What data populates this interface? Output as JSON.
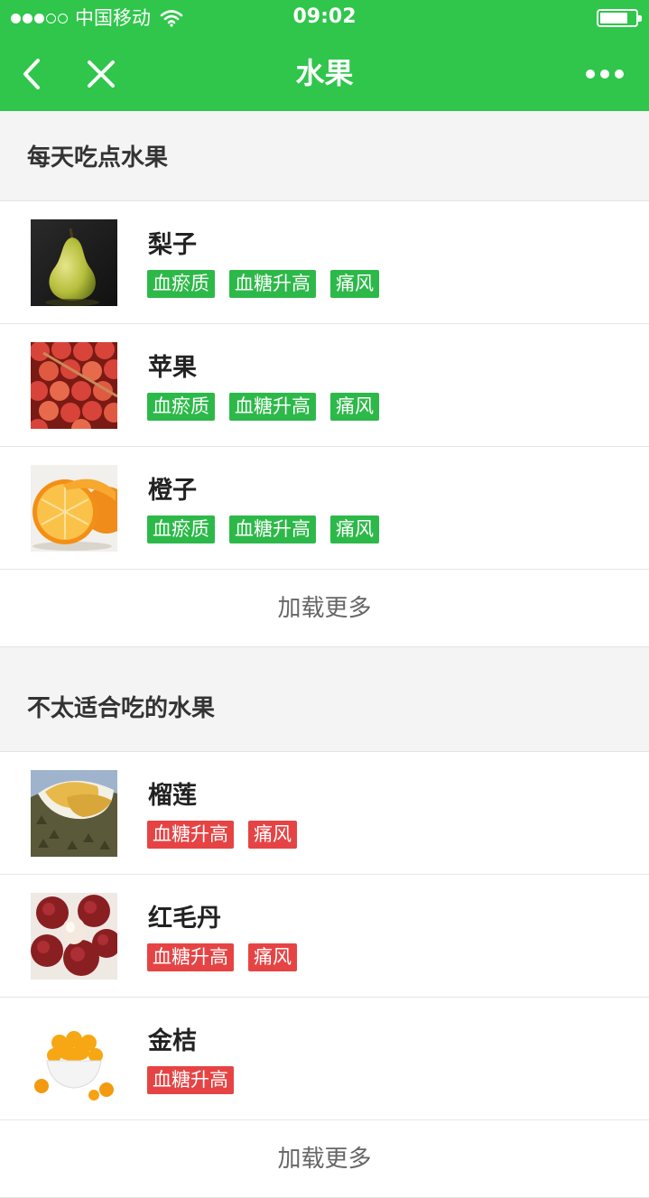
{
  "status_bar": {
    "carrier": "中国移动",
    "time": "09:02"
  },
  "nav": {
    "title": "水果"
  },
  "colors": {
    "primary_green": "#2fc64b",
    "tag_good": "#2db949",
    "tag_bad": "#e64444"
  },
  "sections": [
    {
      "title": "每天吃点水果",
      "items": [
        {
          "name": "梨子",
          "tags": [
            "血瘀质",
            "血糖升高",
            "痛风"
          ],
          "image": "pear-image"
        },
        {
          "name": "苹果",
          "tags": [
            "血瘀质",
            "血糖升高",
            "痛风"
          ],
          "image": "apple-image"
        },
        {
          "name": "橙子",
          "tags": [
            "血瘀质",
            "血糖升高",
            "痛风"
          ],
          "image": "orange-image"
        }
      ],
      "load_more": "加载更多"
    },
    {
      "title": "不太适合吃的水果",
      "items": [
        {
          "name": "榴莲",
          "tags": [
            "血糖升高",
            "痛风"
          ],
          "image": "durian-image"
        },
        {
          "name": "红毛丹",
          "tags": [
            "血糖升高",
            "痛风"
          ],
          "image": "rambutan-image"
        },
        {
          "name": "金桔",
          "tags": [
            "血糖升高"
          ],
          "image": "kumquat-image"
        }
      ],
      "load_more": "加载更多"
    }
  ]
}
